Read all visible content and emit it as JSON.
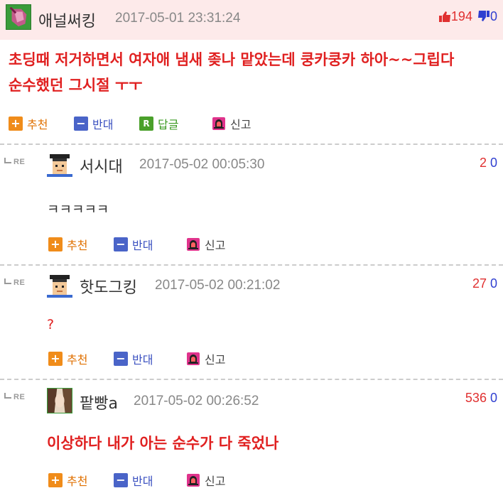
{
  "post": {
    "author": "애널써킹",
    "timestamp": "2017-05-01 23:31:24",
    "upvotes": "194",
    "downvotes": "0",
    "body_line1": "초딩때 저거하면서 여자애 냄새 좆나 맡았는데 쿵카쿵카 하아~~그립다",
    "body_line2": "순수했던 그시절 ㅜㅜ",
    "actions": {
      "recommend": "추천",
      "oppose": "반대",
      "reply": "답글",
      "report": "신고"
    }
  },
  "re_label": "RE",
  "comments": [
    {
      "author": "서시대",
      "timestamp": "2017-05-02 00:05:30",
      "upvotes": "2",
      "downvotes": "0",
      "body": "ㅋㅋㅋㅋㅋ",
      "actions": {
        "recommend": "추천",
        "oppose": "반대",
        "report": "신고"
      }
    },
    {
      "author": "핫도그킹",
      "timestamp": "2017-05-02 00:21:02",
      "upvotes": "27",
      "downvotes": "0",
      "body": "?",
      "actions": {
        "recommend": "추천",
        "oppose": "반대",
        "report": "신고"
      }
    },
    {
      "author": "팥빵a",
      "timestamp": "2017-05-02 00:26:52",
      "upvotes": "536",
      "downvotes": "0",
      "body": "이상하다 내가 아는 순수가 다 죽었나",
      "actions": {
        "recommend": "추천",
        "oppose": "반대",
        "report": "신고"
      }
    }
  ],
  "colors": {
    "header_bg": "#fdeaea",
    "accent_red": "#e02020",
    "down_blue": "#2f3fd0",
    "recommend_orange": "#f08c1a"
  }
}
